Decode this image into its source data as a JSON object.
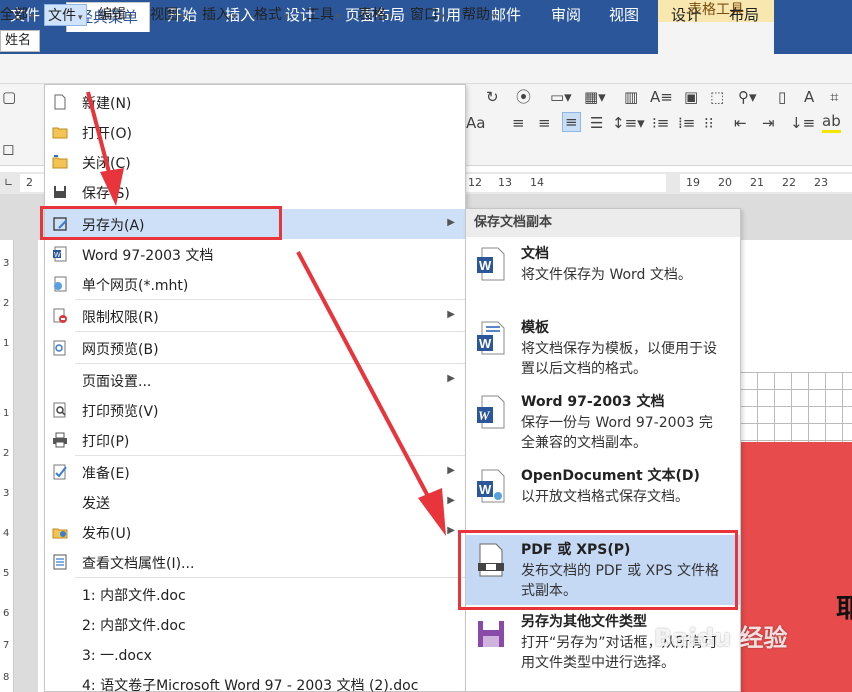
{
  "ribbon": {
    "context_title": "表格工具",
    "tabs": [
      {
        "label": "文件"
      },
      {
        "label": "经典菜单"
      },
      {
        "label": "开始"
      },
      {
        "label": "插入"
      },
      {
        "label": "设计"
      },
      {
        "label": "页面布局"
      },
      {
        "label": "引用"
      },
      {
        "label": "邮件"
      },
      {
        "label": "审阅"
      },
      {
        "label": "视图"
      },
      {
        "label": "设计"
      },
      {
        "label": "布局"
      }
    ]
  },
  "menubar": {
    "items": [
      {
        "label": "全部"
      },
      {
        "label": "文件"
      },
      {
        "label": "编辑"
      },
      {
        "label": "视图"
      },
      {
        "label": "插入"
      },
      {
        "label": "格式"
      },
      {
        "label": "工具"
      },
      {
        "label": "表格"
      },
      {
        "label": "窗口"
      },
      {
        "label": "帮助"
      }
    ]
  },
  "toolbar": {
    "font_name": "姓名",
    "font_size_label": "Aa"
  },
  "ruler": {
    "numbers_left": [
      "2"
    ],
    "numbers_mid": [
      "12",
      "13",
      "14"
    ],
    "numbers_right": [
      "19",
      "20",
      "21",
      "22",
      "23"
    ]
  },
  "vruler": {
    "numbers": [
      "3",
      "2",
      "1",
      "1",
      "2",
      "3",
      "4",
      "5",
      "6",
      "7",
      "8"
    ]
  },
  "file_menu": {
    "items": [
      {
        "label": "新建(N)"
      },
      {
        "label": "打开(O)"
      },
      {
        "label": "关闭(C)"
      },
      {
        "label": "保存(S)"
      },
      {
        "label": "另存为(A)"
      },
      {
        "label": "Word 97-2003 文档"
      },
      {
        "label": "单个网页(*.mht)"
      },
      {
        "label": "限制权限(R)"
      },
      {
        "label": "网页预览(B)"
      },
      {
        "label": "页面设置..."
      },
      {
        "label": "打印预览(V)"
      },
      {
        "label": "打印(P)"
      },
      {
        "label": "准备(E)"
      },
      {
        "label": "发送"
      },
      {
        "label": "发布(U)"
      },
      {
        "label": "查看文档属性(I)..."
      },
      {
        "label": "1: 内部文件.doc"
      },
      {
        "label": "2: 内部文件.doc"
      },
      {
        "label": "3: 一.docx"
      },
      {
        "label": "4: 语文卷子Microsoft Word 97 - 2003 文档 (2).doc"
      }
    ]
  },
  "submenu": {
    "header": "保存文档副本",
    "items": [
      {
        "title": "文档",
        "desc": "将文件保存为 Word 文档。"
      },
      {
        "title": "模板",
        "desc": "将文档保存为模板，以便用于设置以后文档的格式。"
      },
      {
        "title": "Word 97-2003 文档",
        "desc": "保存一份与 Word 97-2003 完全兼容的文档副本。"
      },
      {
        "title": "OpenDocument 文本(D)",
        "desc": "以开放文档格式保存文档。"
      },
      {
        "title": "PDF 或 XPS(P)",
        "desc": "发布文档的 PDF 或 XPS 文件格式副本。"
      },
      {
        "title": "另存为其他文件类型",
        "desc": "打开“另存为”对话框，从所有可用文件类型中进行选择。"
      }
    ]
  },
  "document": {
    "partial_glyph": "耶"
  },
  "watermark": {
    "text": "Baidu 经验"
  },
  "colors": {
    "ribbon_blue": "#2b579a",
    "highlight_red": "#e8343b",
    "menu_hover": "#cde0f7",
    "doc_red": "#e84b4b"
  }
}
